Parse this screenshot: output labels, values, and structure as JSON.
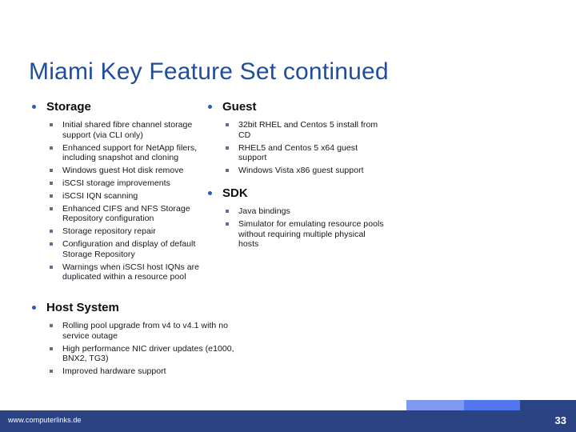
{
  "slide": {
    "title": "Miami Key Feature Set continued",
    "title_color": "#1F4E9C",
    "background_color": "#FFFFFF"
  },
  "sections": {
    "storage": {
      "heading": "Storage",
      "items": [
        "Initial shared fibre channel storage support (via CLI only)",
        "Enhanced support for NetApp filers, including snapshot and cloning",
        "Windows guest Hot disk remove",
        "iSCSI storage improvements",
        "iSCSI IQN scanning",
        "Enhanced CIFS and NFS Storage Repository configuration",
        "Storage repository repair",
        "Configuration and display of default Storage Repository",
        "Warnings when iSCSI host IQNs are duplicated within a resource pool"
      ]
    },
    "guest": {
      "heading": "Guest",
      "items": [
        "32bit RHEL and Centos 5 install from CD",
        "RHEL5 and Centos 5 x64 guest support",
        "Windows Vista x86 guest support"
      ]
    },
    "sdk": {
      "heading": "SDK",
      "items": [
        "Java bindings",
        "Simulator for emulating resource pools without requiring multiple physical hosts"
      ]
    },
    "host_system": {
      "heading": "Host System",
      "items": [
        "Rolling pool upgrade from v4 to v4.1 with no service outage",
        "High performance NIC driver updates (e1000, BNX2, TG3)",
        "Improved hardware support"
      ]
    }
  },
  "footer": {
    "url": "www.computerlinks.de",
    "page_number": "33",
    "bar_color": "#2B4383",
    "block_light_color": "#7E9BF0",
    "block_mid_color": "#5276EE",
    "block_dark_color": "#2A4485"
  }
}
